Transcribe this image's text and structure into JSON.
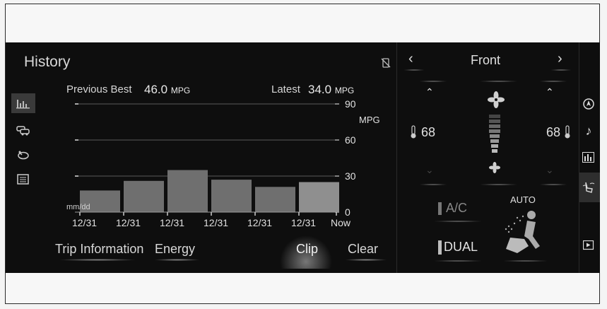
{
  "screen_title": "History",
  "stats": {
    "previous_best_label": "Previous Best",
    "previous_best_value": "46.0",
    "latest_label": "Latest",
    "latest_value": "34.0",
    "unit": "MPG"
  },
  "left_icons": [
    "bar-chart-icon",
    "cars-icon",
    "eco-leaf-icon",
    "list-icon"
  ],
  "chart_data": {
    "type": "bar",
    "categories": [
      "12/31",
      "12/31",
      "12/31",
      "12/31",
      "12/31",
      "12/31",
      "Now"
    ],
    "values": [
      18,
      26,
      35,
      27,
      21,
      25,
      0
    ],
    "y_ticks": [
      "0",
      "30",
      "60",
      "90"
    ],
    "ylabel": "MPG",
    "xlabel": "mm/dd",
    "ylim": [
      0,
      90
    ]
  },
  "bottom_buttons": {
    "trip_info": "Trip Information",
    "energy": "Energy",
    "clip": "Clip",
    "clear": "Clear"
  },
  "climate": {
    "zone_label": "Front",
    "left_temp": "68",
    "right_temp": "68",
    "ac_label": "A/C",
    "dual_label": "DUAL",
    "auto_label": "AUTO"
  },
  "right_icons": [
    "navigation-icon",
    "music-note-icon",
    "bar-chart-icon",
    "seat-airflow-icon",
    "media-play-icon"
  ]
}
